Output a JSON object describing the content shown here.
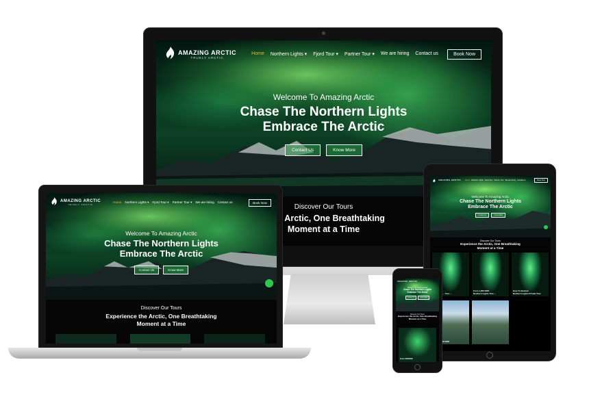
{
  "site": {
    "logo_title": "AMAZING ARCTIC",
    "logo_sub": "TRUELY ARCTIC",
    "nav": [
      "Home",
      "Northern Lights",
      "Fjord Tour",
      "Partner Tour",
      "We are hiring",
      "Contact us"
    ],
    "nav_dropdown": [
      false,
      true,
      true,
      true,
      false,
      false
    ],
    "book_label": "Book Now",
    "hero_welcome": "Welcome To Amazing Arctic",
    "hero_title_line1": "Chase The Northern Lights",
    "hero_title_line2": "Embrace The Arctic",
    "btn_contact": "Contact Us",
    "btn_more": "Know More",
    "tours_title": "Discover Our Tours",
    "tours_sub_line1": "Experience the Arctic, One Breathtaking",
    "tours_sub_line2": "Moment at a Time",
    "imac_tours_sub_line1": "e the Arctic, One Breathtaking",
    "imac_tours_sub_line2": "Moment at a Time"
  },
  "tablet_cards": [
    {
      "label": "Northern ... Tour ...",
      "price": "",
      "scene": "aurora"
    },
    {
      "label": "Northern Lights Tour ...",
      "price": "From 1,000 NOK",
      "scene": "aurora"
    },
    {
      "label": "Northern Lights Private Tour",
      "price": "How To Booked",
      "scene": "aurora"
    },
    {
      "label": "",
      "price": "From 1,120 NOK",
      "scene": "fjord"
    },
    {
      "label": "",
      "price": "",
      "scene": "fjord"
    }
  ],
  "phone_card_price": "From 1000NOK",
  "colors": {
    "accent_active_nav": "#f2b234",
    "whatsapp": "#2fc84c",
    "aurora_green": "#3dd66b"
  },
  "icons": {
    "logo": "flame-icon",
    "apple": "apple-logo-icon",
    "whatsapp": "whatsapp-icon",
    "dropdown": "chevron-down-icon"
  }
}
